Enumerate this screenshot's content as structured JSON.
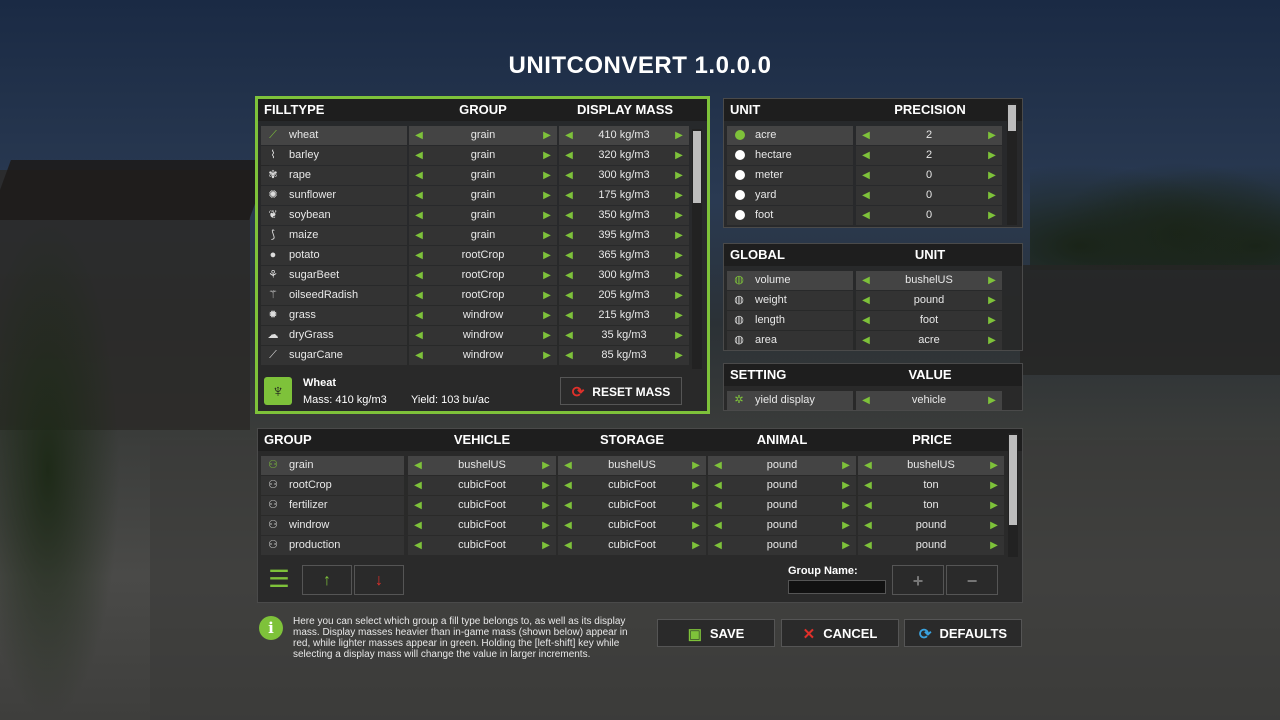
{
  "title": "UNITCONVERT 1.0.0.0",
  "colors": {
    "accent": "#7ec23a",
    "danger": "#e0302a"
  },
  "filltype_panel": {
    "headers": {
      "filltype": "FILLTYPE",
      "group": "GROUP",
      "display_mass": "DISPLAY MASS"
    },
    "rows": [
      {
        "name": "wheat",
        "group": "grain",
        "mass": "410 kg/m3",
        "icon": "wheat-icon"
      },
      {
        "name": "barley",
        "group": "grain",
        "mass": "320 kg/m3",
        "icon": "barley-icon"
      },
      {
        "name": "rape",
        "group": "grain",
        "mass": "300 kg/m3",
        "icon": "rape-icon"
      },
      {
        "name": "sunflower",
        "group": "grain",
        "mass": "175 kg/m3",
        "icon": "sunflower-icon"
      },
      {
        "name": "soybean",
        "group": "grain",
        "mass": "350 kg/m3",
        "icon": "soybean-icon"
      },
      {
        "name": "maize",
        "group": "grain",
        "mass": "395 kg/m3",
        "icon": "maize-icon"
      },
      {
        "name": "potato",
        "group": "rootCrop",
        "mass": "365 kg/m3",
        "icon": "potato-icon"
      },
      {
        "name": "sugarBeet",
        "group": "rootCrop",
        "mass": "300 kg/m3",
        "icon": "sugarbeet-icon"
      },
      {
        "name": "oilseedRadish",
        "group": "rootCrop",
        "mass": "205 kg/m3",
        "icon": "radish-icon"
      },
      {
        "name": "grass",
        "group": "windrow",
        "mass": "215 kg/m3",
        "icon": "grass-icon"
      },
      {
        "name": "dryGrass",
        "group": "windrow",
        "mass": "35 kg/m3",
        "icon": "drygrass-icon"
      },
      {
        "name": "sugarCane",
        "group": "windrow",
        "mass": "85 kg/m3",
        "icon": "sugarcane-icon"
      }
    ],
    "selected": {
      "name": "Wheat",
      "mass": "Mass: 410 kg/m3",
      "yield": "Yield: 103 bu/ac"
    },
    "reset_label": "RESET MASS"
  },
  "unit_panel": {
    "headers": {
      "unit": "UNIT",
      "precision": "PRECISION"
    },
    "rows": [
      {
        "name": "acre",
        "value": "2",
        "on": true
      },
      {
        "name": "hectare",
        "value": "2",
        "on": false
      },
      {
        "name": "meter",
        "value": "0",
        "on": false
      },
      {
        "name": "yard",
        "value": "0",
        "on": false
      },
      {
        "name": "foot",
        "value": "0",
        "on": false
      }
    ]
  },
  "global_panel": {
    "headers": {
      "global": "GLOBAL",
      "unit": "UNIT"
    },
    "rows": [
      {
        "name": "volume",
        "value": "bushelUS"
      },
      {
        "name": "weight",
        "value": "pound"
      },
      {
        "name": "length",
        "value": "foot"
      },
      {
        "name": "area",
        "value": "acre"
      }
    ]
  },
  "setting_panel": {
    "headers": {
      "setting": "SETTING",
      "value": "VALUE"
    },
    "rows": [
      {
        "name": "yield display",
        "value": "vehicle"
      }
    ]
  },
  "group_panel": {
    "headers": {
      "group": "GROUP",
      "vehicle": "VEHICLE",
      "storage": "STORAGE",
      "animal": "ANIMAL",
      "price": "PRICE"
    },
    "rows": [
      {
        "name": "grain",
        "vehicle": "bushelUS",
        "storage": "bushelUS",
        "animal": "pound",
        "price": "bushelUS"
      },
      {
        "name": "rootCrop",
        "vehicle": "cubicFoot",
        "storage": "cubicFoot",
        "animal": "pound",
        "price": "ton"
      },
      {
        "name": "fertilizer",
        "vehicle": "cubicFoot",
        "storage": "cubicFoot",
        "animal": "pound",
        "price": "ton"
      },
      {
        "name": "windrow",
        "vehicle": "cubicFoot",
        "storage": "cubicFoot",
        "animal": "pound",
        "price": "pound"
      },
      {
        "name": "production",
        "vehicle": "cubicFoot",
        "storage": "cubicFoot",
        "animal": "pound",
        "price": "pound"
      }
    ],
    "group_name_label": "Group Name:",
    "group_name_value": ""
  },
  "help_text": "Here you can select which group a fill type belongs to, as well as its display mass. Display masses heavier than in-game mass (shown below) appear in red, while lighter masses appear in green. Holding the [left-shift] key while selecting a display mass will change the value in larger increments.",
  "buttons": {
    "save": "SAVE",
    "cancel": "CANCEL",
    "defaults": "DEFAULTS"
  }
}
